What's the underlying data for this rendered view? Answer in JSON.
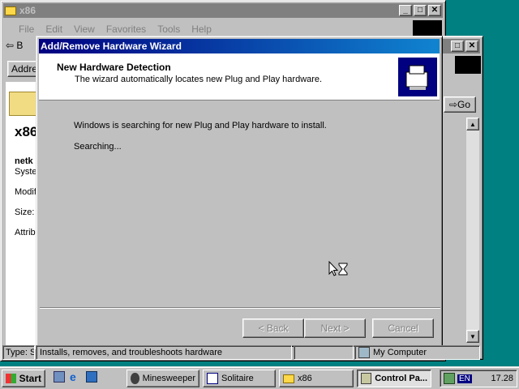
{
  "back_window": {
    "title": "x86",
    "menu": [
      "File",
      "Edit",
      "View",
      "Favorites",
      "Tools",
      "Help"
    ],
    "back_label": "B",
    "address_label": "Addre",
    "folder_title": "x86",
    "item_name": "netk",
    "item_type": "Syste",
    "modified_label": "Modif",
    "size_label": "Size:",
    "attrib_label": "Attrib",
    "status_left": "Type: S"
  },
  "cp_window": {
    "go_label": "Go"
  },
  "wizard": {
    "title": "Add/Remove Hardware Wizard",
    "header_title": "New Hardware Detection",
    "header_subtitle": "The wizard automatically locates new Plug and Play hardware.",
    "body_text": "Windows is searching for new Plug and Play hardware to install.",
    "status_text": "Searching...",
    "back_button": "< Back",
    "next_button": "Next >",
    "cancel_button": "Cancel"
  },
  "status_bar": {
    "description": "Installs, removes, and troubleshoots hardware",
    "zone": "My Computer"
  },
  "taskbar": {
    "start_label": "Start",
    "tasks": [
      "Minesweeper",
      "Solitaire",
      "x86",
      "Control Pa..."
    ],
    "lang": "EN",
    "clock": "17.28"
  },
  "colors": {
    "desktop": "#008080",
    "active_title": "#000080",
    "inactive_title": "#808080",
    "face": "#c0c0c0"
  }
}
